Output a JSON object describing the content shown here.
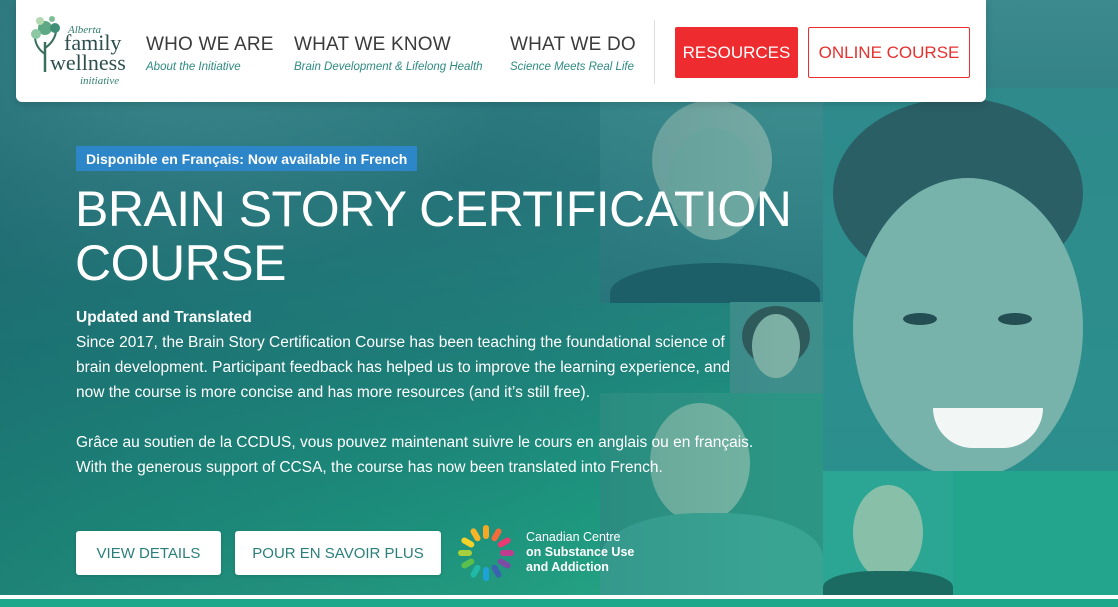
{
  "header": {
    "logo": {
      "line1": "Alberta",
      "line2": "family",
      "line3": "wellness",
      "line4": "initiative"
    },
    "nav": [
      {
        "title": "WHO WE ARE",
        "subtitle": "About the Initiative"
      },
      {
        "title": "WHAT WE KNOW",
        "subtitle": "Brain Development & Lifelong Health"
      },
      {
        "title": "WHAT WE DO",
        "subtitle": "Science Meets Real Life"
      }
    ],
    "resources_label": "RESOURCES",
    "online_course_label": "ONLINE COURSE"
  },
  "hero": {
    "badge": "Disponible en Français: Now available in French",
    "title_line1": "BRAIN STORY CERTIFICATION",
    "title_line2": "COURSE",
    "subheading": "Updated and Translated",
    "paragraph1": "Since 2017, the Brain Story Certification Course has been teaching the foundational science of brain development. Participant feedback has helped us to improve the learning experience, and now the course is more concise and has more resources (and it’s still free).",
    "paragraph2": "Grâce au soutien de la CCDUS, vous pouvez maintenant suivre le cours en anglais ou en français.",
    "paragraph3": "With the generous support of CCSA, the course has now been translated into French.",
    "view_details_label": "VIEW DETAILS",
    "pour_en_savoir_label": "POUR EN SAVOIR PLUS",
    "partner": {
      "line1": "Canadian Centre",
      "line2": "on Substance Use",
      "line3": "and Addiction"
    }
  },
  "colors": {
    "accent_red": "#ee2c2f",
    "badge_blue": "#2d86c8",
    "nav_sub_teal": "#2d8a82",
    "hero_teal": "#2a7f83"
  }
}
